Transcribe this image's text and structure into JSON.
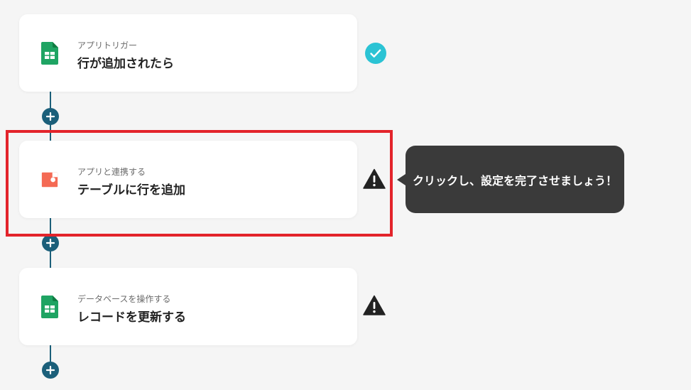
{
  "colors": {
    "background": "#f5f5f5",
    "connector": "#1b5f7a",
    "check": "#2bc3d4",
    "warning": "#222222",
    "highlight": "#e3242b",
    "tooltip_bg": "#3a3a3a",
    "sheets_green": "#1fa463",
    "coda_red": "#f46a54"
  },
  "steps": [
    {
      "icon": "google-sheets-icon",
      "subtitle": "アプリトリガー",
      "title": "行が追加されたら",
      "status": "check-icon"
    },
    {
      "icon": "coda-icon",
      "subtitle": "アプリと連携する",
      "title": "テーブルに行を追加",
      "status": "warning-icon"
    },
    {
      "icon": "google-sheets-icon",
      "subtitle": "データベースを操作する",
      "title": "レコードを更新する",
      "status": "warning-icon"
    }
  ],
  "tooltip": {
    "text": "クリックし、設定を完了させましょう！"
  }
}
